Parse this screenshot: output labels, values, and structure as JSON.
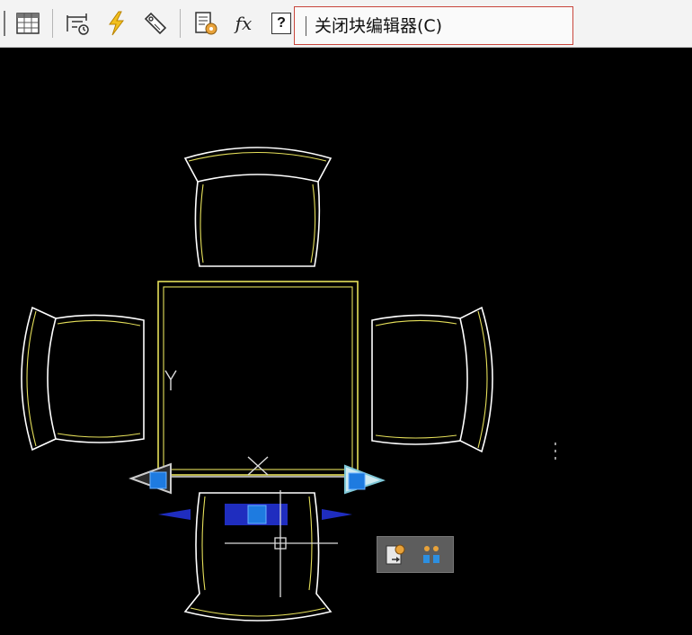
{
  "toolbar": {
    "buttons": [
      {
        "name": "table-icon",
        "tooltip": ""
      },
      {
        "name": "attribute-definition-icon",
        "tooltip": ""
      },
      {
        "name": "lightning-icon",
        "tooltip": ""
      },
      {
        "name": "tag-icon",
        "tooltip": ""
      },
      {
        "name": "block-properties-icon",
        "tooltip": ""
      },
      {
        "name": "function-fx-icon",
        "tooltip": ""
      },
      {
        "name": "help-question-icon",
        "tooltip": ""
      }
    ],
    "fx_glyph": "fx",
    "help_glyph": "?",
    "tooltip_text": "关闭块编辑器(C)"
  },
  "drawing": {
    "background": "#000000",
    "line_color": "#ffffff",
    "accent_line_color": "#e6e05a",
    "grip_color": "#1e7be0",
    "ucs_label": "Y"
  },
  "mini_toolbar": {
    "buttons": [
      {
        "name": "insert-point-icon"
      },
      {
        "name": "grip-tools-icon"
      }
    ]
  }
}
